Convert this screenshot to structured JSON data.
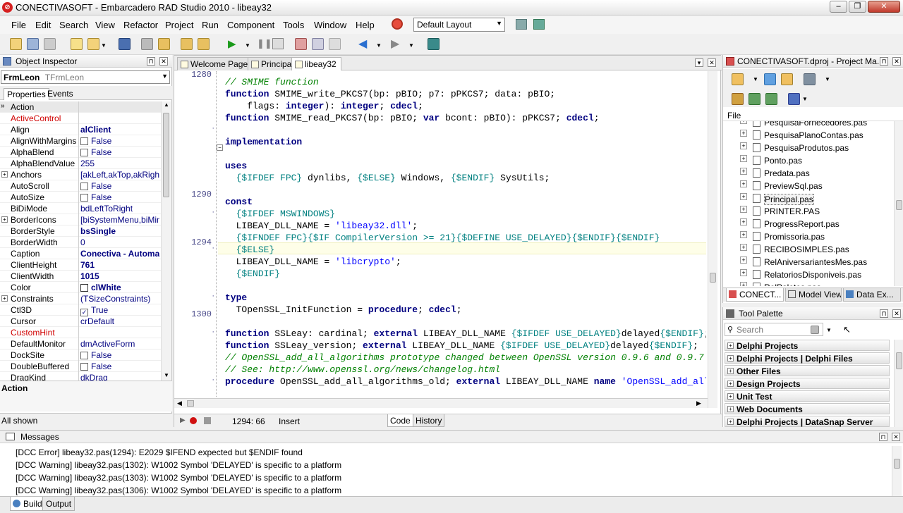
{
  "window": {
    "title": "CONECTIVASOFT - Embarcadero RAD Studio 2010 - libeay32",
    "app_icon": "rad-studio-logo-icon",
    "buttons": [
      "minimize",
      "restore",
      "close"
    ]
  },
  "menu": {
    "items": [
      "File",
      "Edit",
      "Search",
      "View",
      "Refactor",
      "Project",
      "Run",
      "Component",
      "Tools",
      "Window",
      "Help"
    ],
    "layout_selected": "Default Layout"
  },
  "object_inspector": {
    "title": "Object Inspector",
    "selected_object": "FrmLeon",
    "selected_class": "TFrmLeon",
    "tabs": [
      "Properties",
      "Events"
    ],
    "properties": [
      {
        "name": "Action",
        "value": "",
        "style": "selected"
      },
      {
        "name": "ActiveControl",
        "value": "",
        "style": "red"
      },
      {
        "name": "Align",
        "value": "alClient",
        "style": "bold"
      },
      {
        "name": "AlignWithMargins",
        "value": "False",
        "style": "check"
      },
      {
        "name": "AlphaBlend",
        "value": "False",
        "style": "check"
      },
      {
        "name": "AlphaBlendValue",
        "value": "255",
        "style": "normal"
      },
      {
        "name": "Anchors",
        "value": "[akLeft,akTop,akRight,",
        "style": "expand"
      },
      {
        "name": "AutoScroll",
        "value": "False",
        "style": "check"
      },
      {
        "name": "AutoSize",
        "value": "False",
        "style": "check"
      },
      {
        "name": "BiDiMode",
        "value": "bdLeftToRight",
        "style": "normal"
      },
      {
        "name": "BorderIcons",
        "value": "[biSystemMenu,biMinim",
        "style": "expand"
      },
      {
        "name": "BorderStyle",
        "value": "bsSingle",
        "style": "bold"
      },
      {
        "name": "BorderWidth",
        "value": "0",
        "style": "normal"
      },
      {
        "name": "Caption",
        "value": "Conectiva - Automa",
        "style": "bold"
      },
      {
        "name": "ClientHeight",
        "value": "761",
        "style": "bold"
      },
      {
        "name": "ClientWidth",
        "value": "1015",
        "style": "bold"
      },
      {
        "name": "Color",
        "value": "clWhite",
        "style": "color"
      },
      {
        "name": "Constraints",
        "value": "(TSizeConstraints)",
        "style": "expand"
      },
      {
        "name": "Ctl3D",
        "value": "True",
        "style": "checked"
      },
      {
        "name": "Cursor",
        "value": "crDefault",
        "style": "normal"
      },
      {
        "name": "CustomHint",
        "value": "",
        "style": "red"
      },
      {
        "name": "DefaultMonitor",
        "value": "dmActiveForm",
        "style": "normal"
      },
      {
        "name": "DockSite",
        "value": "False",
        "style": "check"
      },
      {
        "name": "DoubleBuffered",
        "value": "False",
        "style": "check"
      },
      {
        "name": "DragKind",
        "value": "dkDrag",
        "style": "normal"
      }
    ],
    "description_label": "Action",
    "footer": "All shown"
  },
  "editor": {
    "tabs": [
      "Welcome Page",
      "Principal",
      "libeay32"
    ],
    "active_tab": "libeay32",
    "line_numbers": [
      {
        "n": "1280",
        "row": 0
      },
      {
        "n": "1290",
        "row": 10
      },
      {
        "n": "1294",
        "row": 14
      },
      {
        "n": "1300",
        "row": 20
      }
    ],
    "code_lines": [
      "",
      "// SMIME function",
      "function SMIME_write_PKCS7(bp: pBIO; p7: pPKCS7; data: pBIO;",
      "    flags: integer): integer; cdecl;",
      "function SMIME_read_PKCS7(bp: pBIO; var bcont: pBIO): pPKCS7; cdecl;",
      "",
      "implementation",
      "",
      "uses",
      "  {$IFDEF FPC} dynlibs, {$ELSE} Windows, {$ENDIF} SysUtils;",
      "",
      "const",
      "  {$IFDEF MSWINDOWS}",
      "  LIBEAY_DLL_NAME = 'libeay32.dll';",
      "  {$IFNDEF FPC}{$IF CompilerVersion >= 21}{$DEFINE USE_DELAYED}{$ENDIF}{$ENDIF}",
      "  {$ELSE}",
      "  LIBEAY_DLL_NAME = 'libcrypto';",
      "  {$ENDIF}",
      "",
      "type",
      "  TOpenSSL_InitFunction = procedure; cdecl;",
      "",
      "function SSLeay: cardinal; external LIBEAY_DLL_NAME {$IFDEF USE_DELAYED}delayed{$ENDIF};",
      "function SSLeay_version; external LIBEAY_DLL_NAME {$IFDEF USE_DELAYED}delayed{$ENDIF};",
      "// OpenSSL_add_all_algorithms prototype changed between OpenSSL version 0.9.6 and 0.9.7",
      "// See: http://www.openssl.org/news/changelog.html",
      "procedure OpenSSL_add_all_algorithms_old; external LIBEAY_DLL_NAME name 'OpenSSL_add_all_algorithms';"
    ],
    "status": {
      "position": "1294:  66",
      "mode": "Insert",
      "view_tabs": [
        "Code",
        "History"
      ]
    }
  },
  "project_manager": {
    "title": "CONECTIVASOFT.dproj - Project Ma...",
    "column_header": "File",
    "files": [
      "PesquisaFornecedores.pas",
      "PesquisaPlanoContas.pas",
      "PesquisaProdutos.pas",
      "Ponto.pas",
      "Predata.pas",
      "PreviewSql.pas",
      "Principal.pas",
      "PRINTER.PAS",
      "ProgressReport.pas",
      "Promissoria.pas",
      "RECIBOSIMPLES.pas",
      "RelAniversariantesMes.pas",
      "RelatoriosDisponiveis.pas",
      "RelPaletes.pas"
    ],
    "bottom_tabs": [
      "CONECT...",
      "Model View",
      "Data Ex..."
    ]
  },
  "tool_palette": {
    "title": "Tool Palette",
    "search_placeholder": "Search",
    "categories": [
      "Delphi Projects",
      "Delphi Projects | Delphi Files",
      "Other Files",
      "Design Projects",
      "Unit Test",
      "Web Documents",
      "Delphi Projects | DataSnap Server"
    ]
  },
  "messages": {
    "title": "Messages",
    "items": [
      "[DCC Error] libeay32.pas(1294): E2029 $IFEND expected but $ENDIF found",
      "[DCC Warning] libeay32.pas(1302): W1002 Symbol 'DELAYED' is specific to a platform",
      "[DCC Warning] libeay32.pas(1303): W1002 Symbol 'DELAYED' is specific to a platform",
      "[DCC Warning] libeay32.pas(1306): W1002 Symbol 'DELAYED' is specific to a platform"
    ],
    "tabs": [
      "Build",
      "Output"
    ]
  }
}
